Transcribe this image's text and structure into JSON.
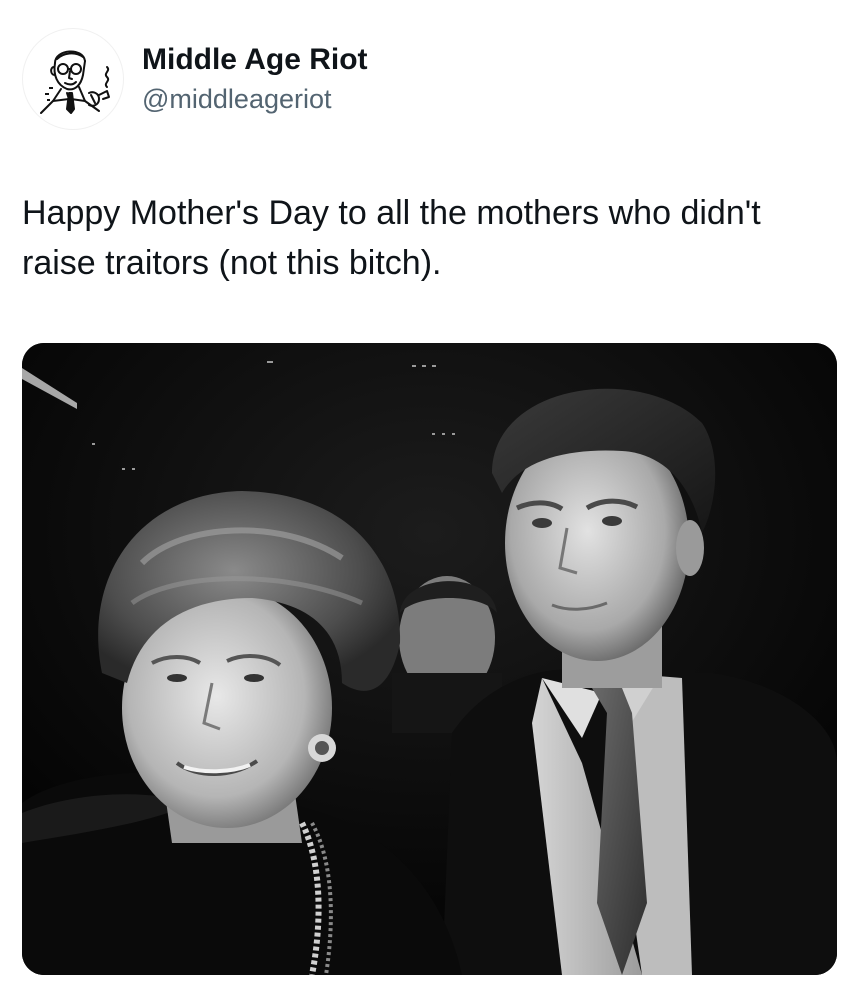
{
  "author": {
    "display_name": "Middle Age Riot",
    "handle": "@middleageriot",
    "avatar_icon": "vintage-man-smoking-pipe-illustration"
  },
  "tweet": {
    "text": "Happy Mother's Day to all the mothers who didn't raise traitors (not this bitch)."
  },
  "media": {
    "type": "black-and-white photograph",
    "icon": "photo"
  },
  "colors": {
    "text_primary": "#0f1419",
    "text_secondary": "#536471",
    "background": "#ffffff"
  }
}
